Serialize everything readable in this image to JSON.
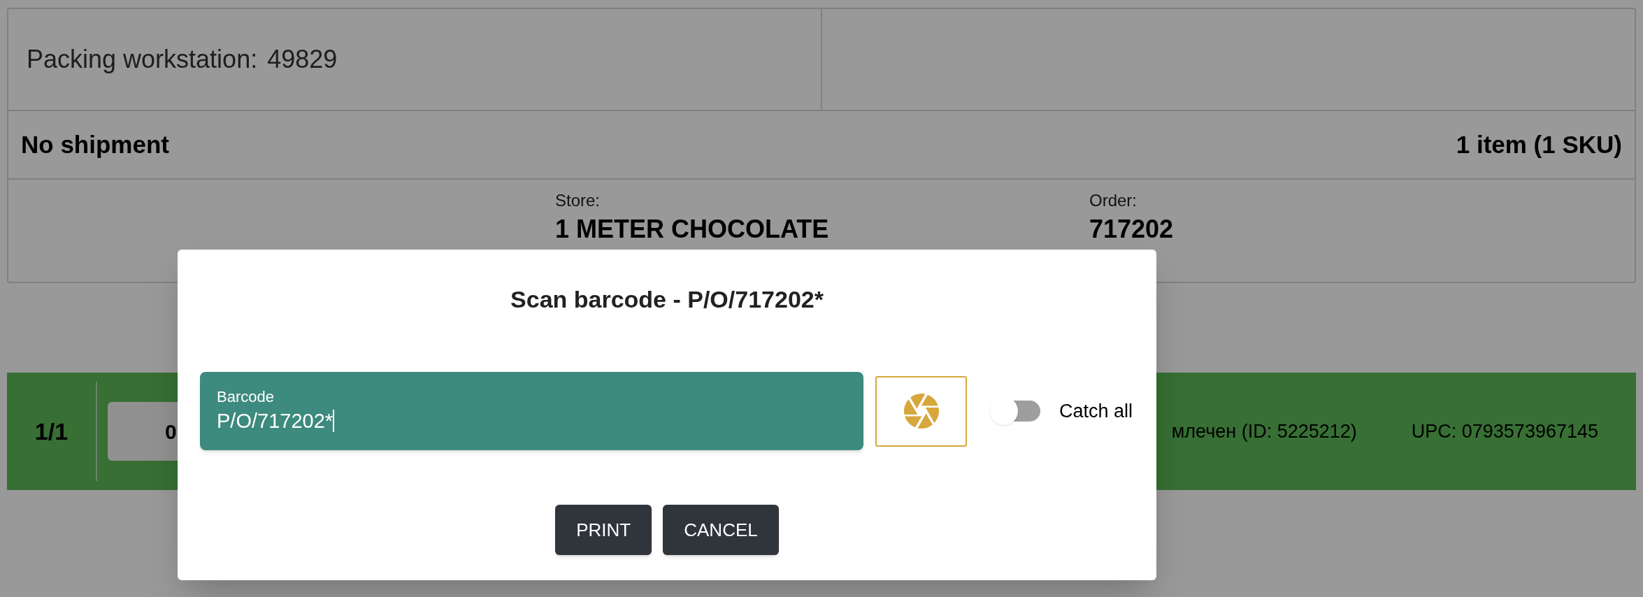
{
  "header": {
    "workstation_label": "Packing workstation:",
    "workstation_id": "49829"
  },
  "shipment": {
    "title": "No shipment",
    "count": "1 item (1 SKU)"
  },
  "details": [
    {
      "label": "Store:",
      "value": "1 METER CHOCOLATE"
    },
    {
      "label": "Order:",
      "value": "717202"
    }
  ],
  "item_row": {
    "position": "1/1",
    "quantity": "0",
    "name": "млечен (ID: 5225212)",
    "upc": "UPC: 0793573967145"
  },
  "dialog": {
    "title": "Scan barcode - P/O/717202*",
    "field": {
      "label": "Barcode",
      "value": "P/O/717202*"
    },
    "catch_all": {
      "label": "Catch all",
      "on": false
    },
    "buttons": [
      "PRINT",
      "CANCEL"
    ]
  }
}
